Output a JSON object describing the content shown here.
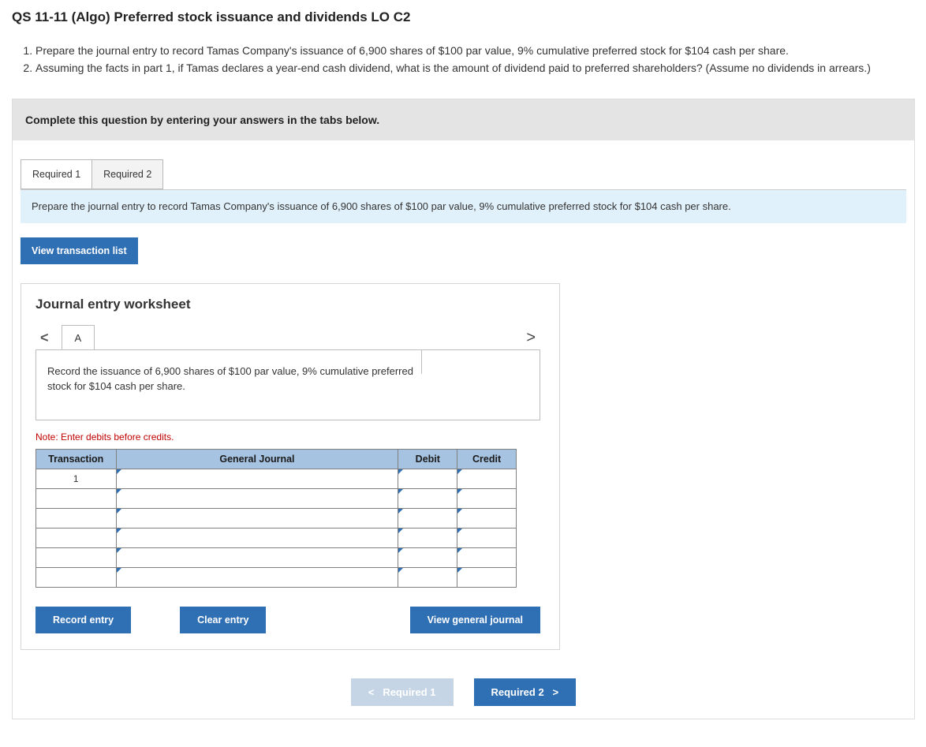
{
  "title": "QS 11-11 (Algo) Preferred stock issuance and dividends LO C2",
  "problem": {
    "item1_num": "1.",
    "item1": "Prepare the journal entry to record Tamas Company's issuance of 6,900 shares of $100 par value, 9% cumulative preferred stock for $104 cash per share.",
    "item2_num": "2.",
    "item2": "Assuming the facts in part 1, if Tamas declares a year-end cash dividend, what is the amount of dividend paid to preferred shareholders? (Assume no dividends in arrears.)"
  },
  "instruction_bar": "Complete this question by entering your answers in the tabs below.",
  "tabs": {
    "req1": "Required 1",
    "req2": "Required 2"
  },
  "tab_instruction": "Prepare the journal entry to record Tamas Company's issuance of 6,900 shares of $100 par value, 9% cumulative preferred stock for $104 cash per share.",
  "view_trans": "View transaction list",
  "worksheet": {
    "title": "Journal entry worksheet",
    "nav_tab": "A",
    "arrow_left": "<",
    "arrow_right": ">",
    "desc": "Record the issuance of 6,900 shares of $100 par value, 9% cumulative preferred stock for $104 cash per share.",
    "note": "Note: Enter debits before credits.",
    "headers": {
      "transaction": "Transaction",
      "general_journal": "General Journal",
      "debit": "Debit",
      "credit": "Credit"
    },
    "first_trans": "1",
    "buttons": {
      "record": "Record entry",
      "clear": "Clear entry",
      "view": "View general journal"
    }
  },
  "nav_bottom": {
    "prev_chev": "<",
    "prev": "Required 1",
    "next": "Required 2",
    "next_chev": ">"
  }
}
